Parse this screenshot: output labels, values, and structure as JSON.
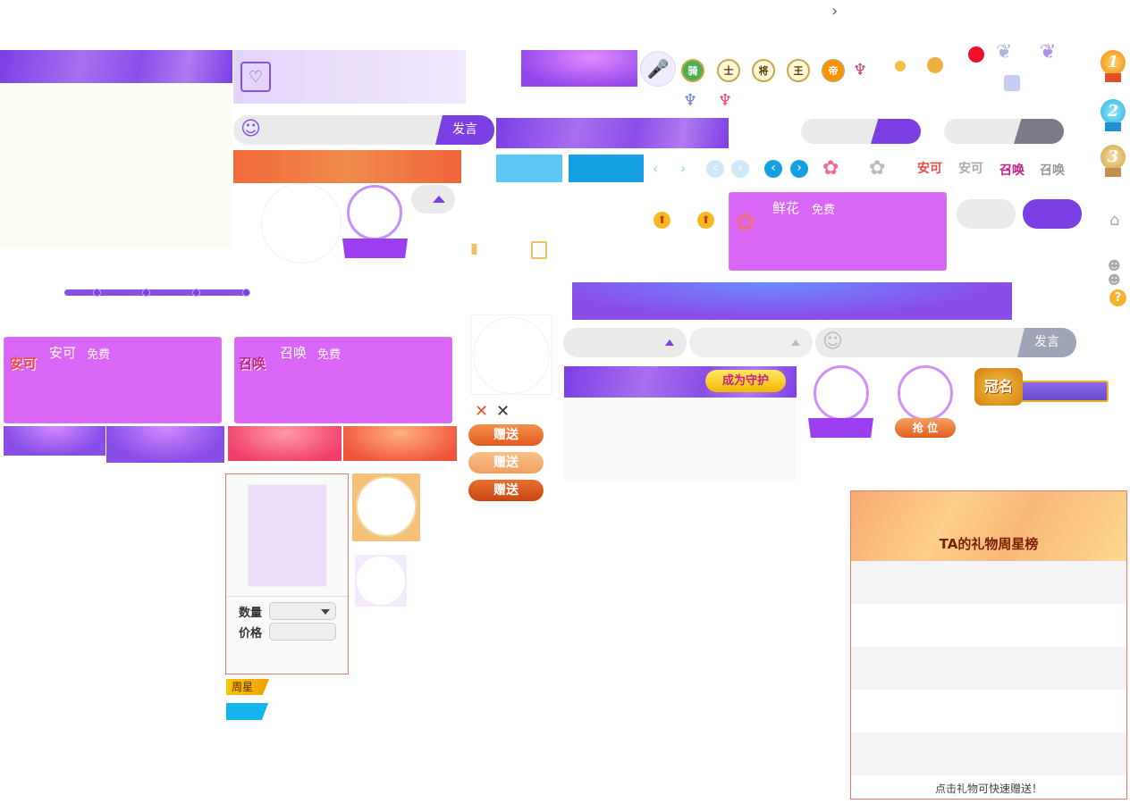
{
  "top_chevron": "›",
  "chat_input": {
    "send_label": "发言",
    "smile": "☺"
  },
  "chat_input_disabled": {
    "send_label": "发言",
    "smile": "☺"
  },
  "gifts": [
    {
      "name": "鲜花",
      "tag": "免费",
      "icon": "flower-icon"
    },
    {
      "name": "安可",
      "tag": "免费",
      "icon": "encore-icon"
    },
    {
      "name": "召唤",
      "tag": "免费",
      "icon": "summon-icon"
    }
  ],
  "encore_sticker": "安可",
  "summon_sticker": "召唤",
  "become_guardian": "成为守护",
  "grab_seat": "抢 位",
  "crown_name": "冠名",
  "send_buttons": [
    "赠送",
    "赠送",
    "赠送"
  ],
  "close_glyphs": [
    "✕",
    "✕"
  ],
  "gift_panel": {
    "quantity_label": "数量",
    "price_label": "价格"
  },
  "week_star_tag": "周星",
  "level_badges": [
    "骑",
    "士",
    "将",
    "王",
    "帝"
  ],
  "medals": [
    "1",
    "2",
    "3"
  ],
  "weekly_board": {
    "title": "TA的礼物周星榜",
    "footer": "点击礼物可快速赠送！",
    "rows": 5
  },
  "help_glyph": "?",
  "colors": {
    "purple": "#8a4ee8",
    "gift_card": "#d966f6",
    "orange": "#f07a3a",
    "blue": "#16a0e4",
    "light_blue": "#5bc8f5",
    "red_border": "#e07b6a"
  }
}
